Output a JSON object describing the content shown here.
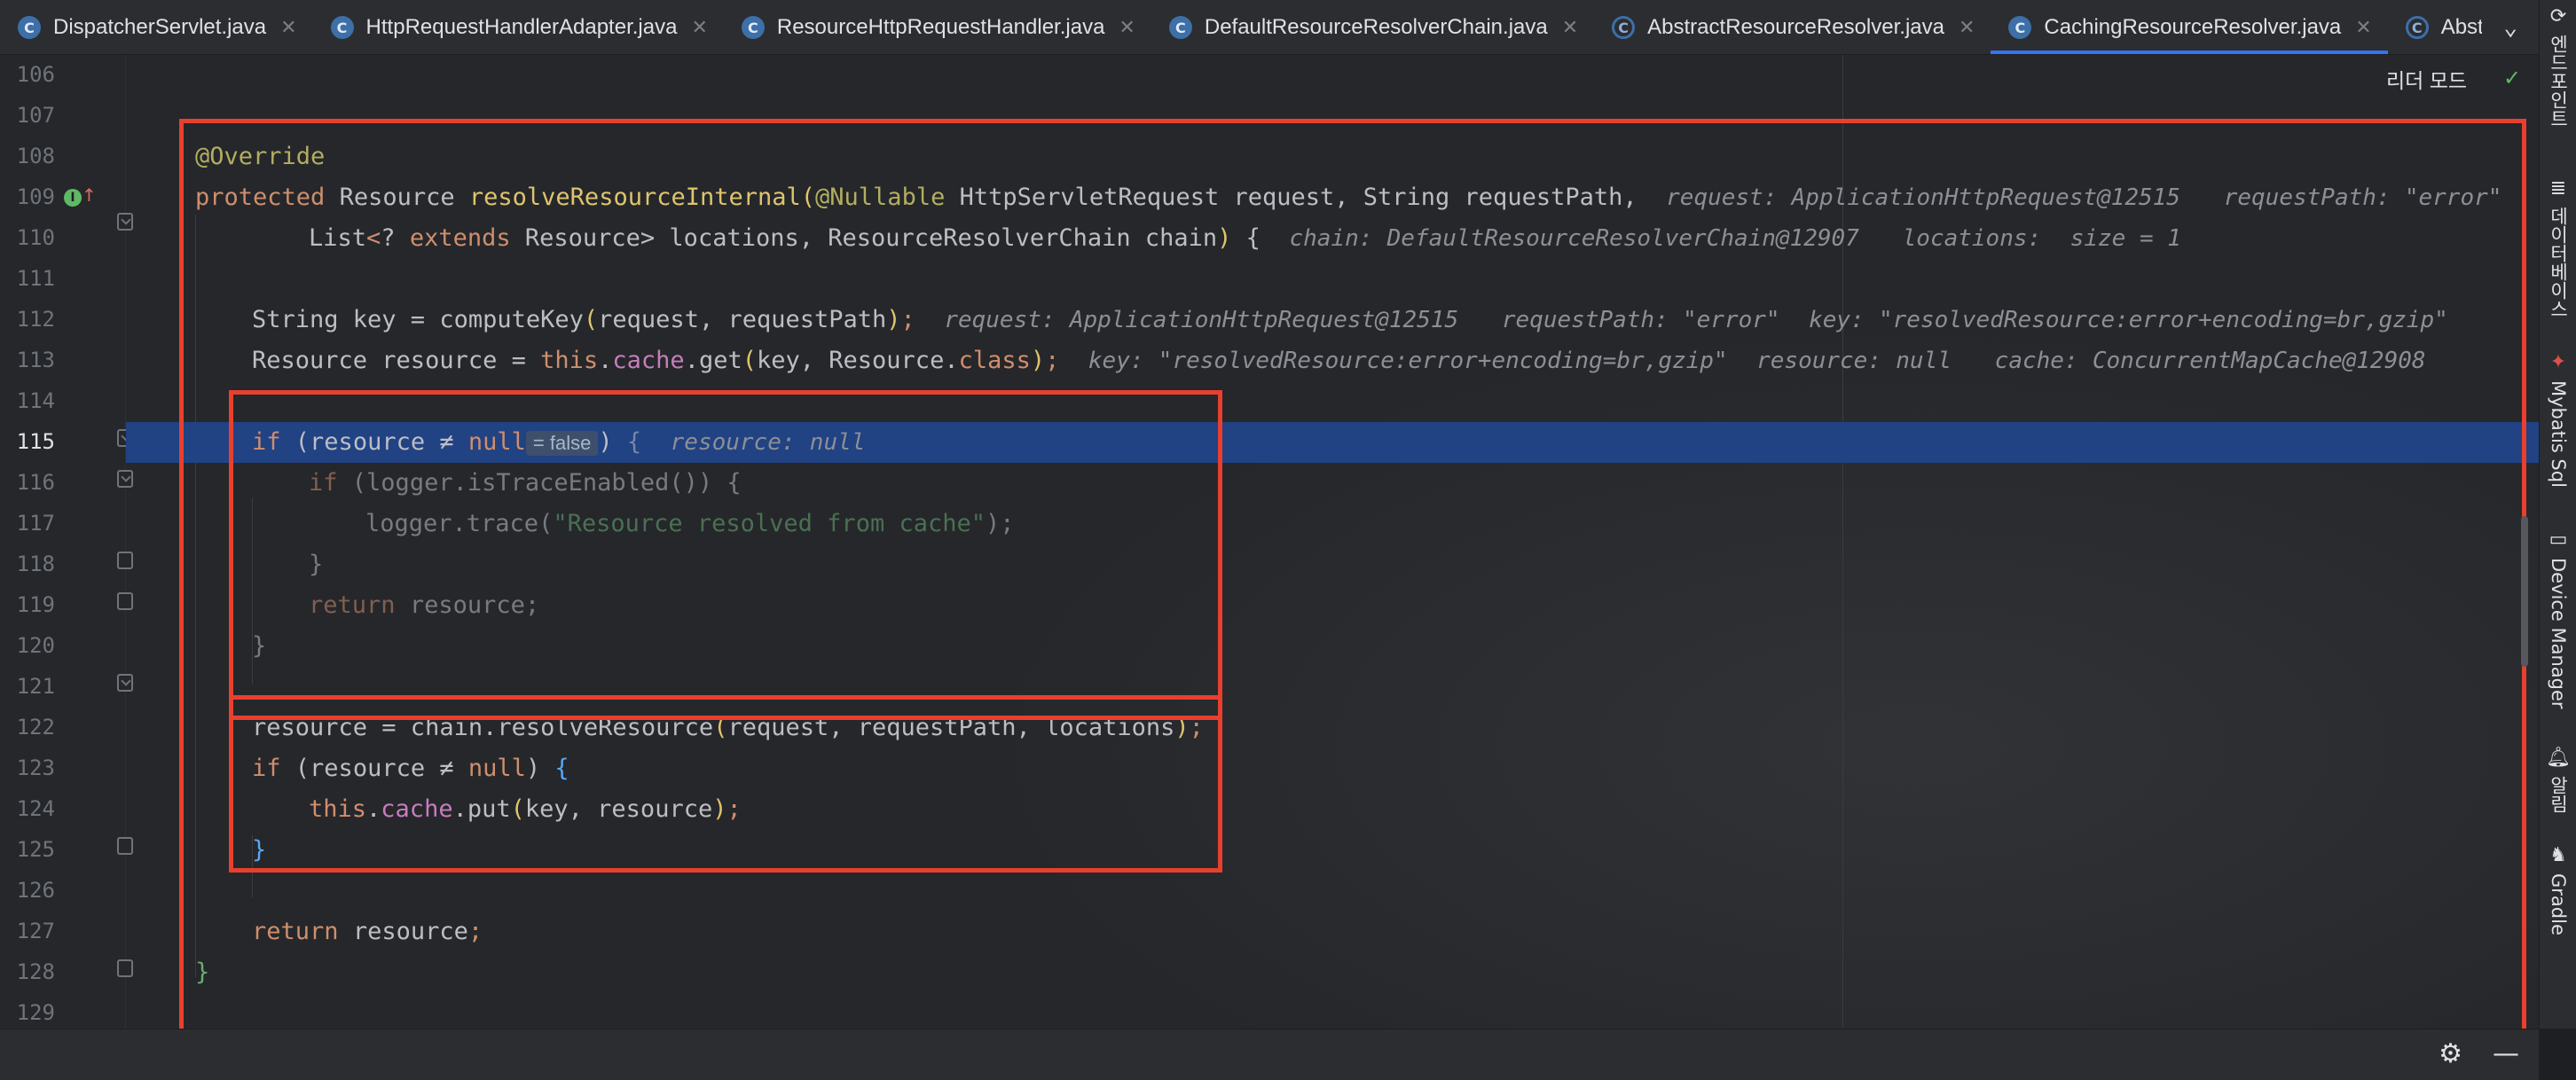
{
  "tabs": [
    {
      "label": "DispatcherServlet.java",
      "icon": "class-icon",
      "active": false
    },
    {
      "label": "HttpRequestHandlerAdapter.java",
      "icon": "class-icon",
      "active": false
    },
    {
      "label": "ResourceHttpRequestHandler.java",
      "icon": "class-icon",
      "active": false
    },
    {
      "label": "DefaultResourceResolverChain.java",
      "icon": "class-icon",
      "active": false
    },
    {
      "label": "AbstractResourceResolver.java",
      "icon": "abstract-class-icon",
      "active": false
    },
    {
      "label": "CachingResourceResolver.java",
      "icon": "class-icon",
      "active": true
    },
    {
      "label": "AbstractH",
      "icon": "abstract-class-icon",
      "active": false
    }
  ],
  "reader_mode_label": "리더 모드",
  "right_tools": [
    "엔드포인트",
    "데이터베이스",
    "Mybatis Sql",
    "Device Manager",
    "알림",
    "Gradle"
  ],
  "line_numbers": [
    "106",
    "107",
    "108",
    "109",
    "110",
    "111",
    "112",
    "113",
    "114",
    "115",
    "116",
    "117",
    "118",
    "119",
    "120",
    "121",
    "122",
    "123",
    "124",
    "125",
    "126",
    "127",
    "128",
    "129"
  ],
  "current_line": "115",
  "hints": {
    "l109_request": "request:",
    "l109_request_val": "ApplicationHttpRequest@12515",
    "l109_path": "requestPath:",
    "l109_path_val": "\"error\"",
    "l110_chain": "chain:",
    "l110_chain_val": "DefaultResourceResolverChain@12907",
    "l110_loc": "locations:",
    "l110_loc_val": "size = 1",
    "l112_request": "request:",
    "l112_request_val": "ApplicationHttpRequest@12515",
    "l112_path": "requestPath:",
    "l112_path_val": "\"error\"",
    "l112_key": "key:",
    "l112_key_val": "\"resolvedResource:error+encoding=br,gzip\"",
    "l113_key": "key:",
    "l113_key_val": "\"resolvedResource:error+encoding=br,gzip\"",
    "l113_res": "resource:",
    "l113_res_val": "null",
    "l113_cache": "cache:",
    "l113_cache_val": "ConcurrentMapCache@12908",
    "l115_inline": "= false",
    "l115_res": "resource:",
    "l115_res_val": "null"
  },
  "code": {
    "override": "@Override",
    "protected": "protected",
    "resource_type": "Resource",
    "method_name": "resolveResourceInternal",
    "nullable": "@Nullable",
    "params1": "HttpServletRequest request, String requestPath,",
    "list": "List",
    "extends": "extends",
    "params2_a": "Resource> locations, ResourceResolverChain chain",
    "l112_a": "String key = ",
    "l112_fn": "computeKey",
    "l112_b": "request, requestPath",
    "l113_a": "Resource resource = ",
    "this": "this",
    "cache": "cache",
    "get": "get",
    "l113_b": "key, Resource.",
    "class": "class",
    "if": "if",
    "l115_a": "resource ≠ ",
    "null": "null",
    "l116": "logger.isTraceEnabled()",
    "l117_a": "logger.trace(",
    "l117_str": "\"Resource resolved from cache\"",
    "return": "return",
    "resource_var": "resource",
    "l122_a": "resource = chain.",
    "l122_fn": "resolveResource",
    "l122_b": "request, requestPath, locations",
    "put": "put",
    "l124_b": "key, resource"
  }
}
